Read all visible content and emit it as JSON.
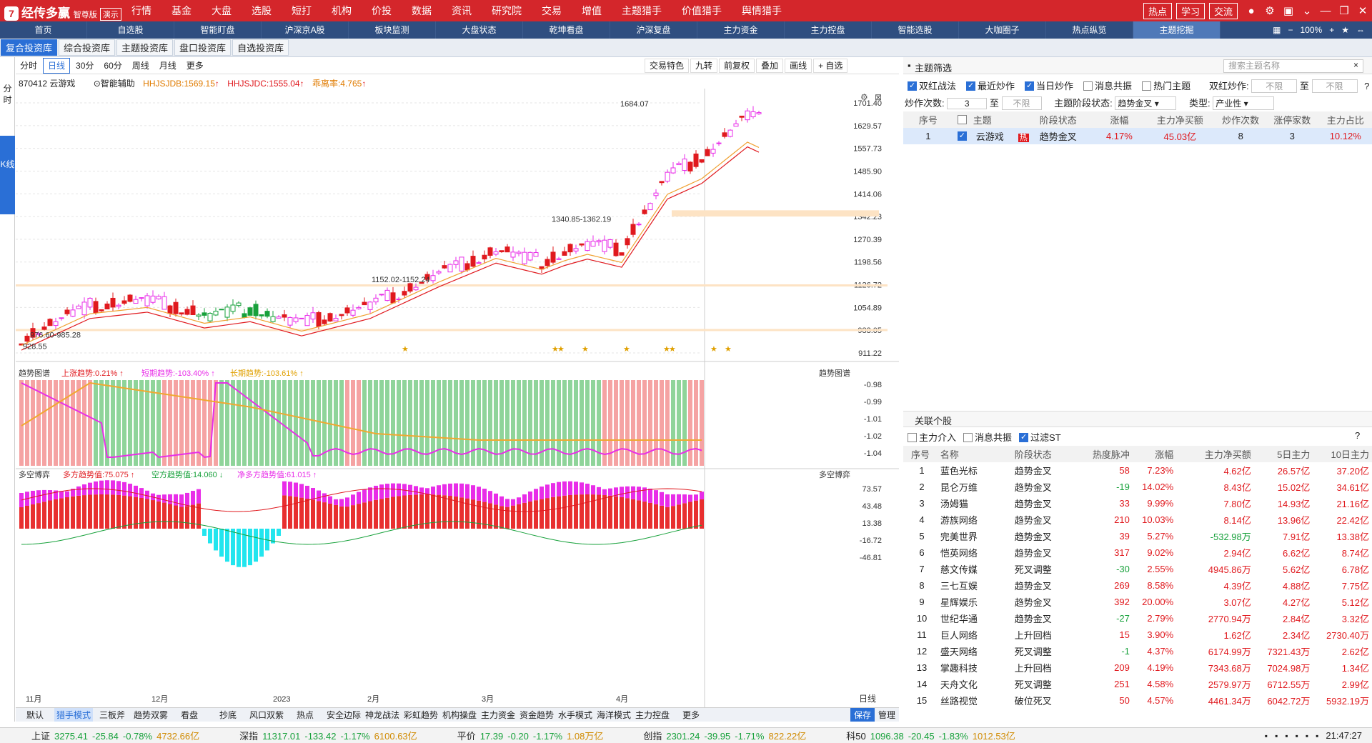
{
  "app": {
    "logo_glyph": "7",
    "title": "经传多赢",
    "edition": "智尊版",
    "demo": "演示"
  },
  "topmenu": [
    "行情",
    "基金",
    "大盘",
    "选股",
    "短打",
    "机构",
    "价投",
    "数据",
    "资讯",
    "研究院",
    "交易",
    "增值",
    "主题猎手",
    "价值猎手",
    "舆情猎手"
  ],
  "topright": {
    "btns": [
      "热点",
      "学习",
      "交流"
    ],
    "icons": [
      "user-icon",
      "gear-icon",
      "window-icon",
      "chevron-down-icon",
      "minimize-icon",
      "restore-icon",
      "close-icon"
    ]
  },
  "nav": [
    "首页",
    "自选股",
    "智能盯盘",
    "沪深京A股",
    "板块监测",
    "大盘状态",
    "乾坤看盘",
    "沪深复盘",
    "主力资金",
    "主力控盘",
    "智能选股",
    "大咖圈子",
    "热点纵览",
    "主题挖掘"
  ],
  "nav_active": 13,
  "navright": {
    "zoom": "100%"
  },
  "tabs": [
    "复合投资库",
    "综合投资库",
    "主题投资库",
    "盘口投资库",
    "自选投资库"
  ],
  "left_tabs": {
    "fenshi": "分时",
    "kxian": "K线"
  },
  "chart_periods": [
    "分时",
    "日线",
    "30分",
    "60分",
    "周线",
    "月线",
    "更多"
  ],
  "chart_period_active": 1,
  "chart_tools": [
    "交易特色",
    "九转",
    "前复权",
    "叠加",
    "画线",
    "+ 自选"
  ],
  "info": {
    "code": "870412 云游戏",
    "assist": "智能辅助",
    "hhjsjdb": "HHJSJDB:1569.15",
    "hhjsjdc": "HHJSJDC:1555.04",
    "dev": "乖离率:4.765"
  },
  "price_axis": [
    "1701.40",
    "1629.57",
    "1557.73",
    "1485.90",
    "1414.06",
    "1342.23",
    "1270.39",
    "1198.56",
    "1126.72",
    "1054.89",
    "983.05",
    "911.22"
  ],
  "annotations": {
    "high": "1684.07",
    "zone1": "1340.85-1362.19",
    "zone2": "1152.02-1152.24",
    "zone3": "976.60-985.28",
    "low": "928.55"
  },
  "trend": {
    "title": "趋势图谱",
    "a": "上涨趋势:0.21%",
    "b": "短期趋势:-103.40%",
    "c": "长期趋势:-103.61%",
    "axis": [
      "-0.98",
      "-0.99",
      "-1.01",
      "-1.02",
      "-1.04"
    ]
  },
  "dk": {
    "title": "多空博弈",
    "a": "多方趋势值:75.075",
    "b": "空方趋势值:14.060",
    "c": "净多方趋势值:61.015",
    "axis": [
      "73.57",
      "43.48",
      "13.38",
      "-16.72",
      "-46.81"
    ]
  },
  "months": [
    "11月",
    "12月",
    "2023",
    "2月",
    "3月",
    "4月"
  ],
  "period_label": "日线",
  "bottom_tabs": [
    "默认",
    "猎手模式",
    "三板斧",
    "趋势双雾",
    "看盘",
    "抄底",
    "风口双紫",
    "热点",
    "安全边际",
    "神龙战法",
    "彩虹趋势",
    "机构操盘",
    "主力资金",
    "资金趋势",
    "水手模式",
    "海洋模式",
    "主力控盘",
    "更多"
  ],
  "bottom_active": 1,
  "bottom_right": [
    "保存",
    "管理"
  ],
  "theme_filter": {
    "title": "主题筛选",
    "search_ph": "搜索主题名称",
    "checks": [
      {
        "l": "双红战法",
        "on": true
      },
      {
        "l": "最近炒作",
        "on": true
      },
      {
        "l": "当日炒作",
        "on": true
      },
      {
        "l": "消息共振",
        "on": false
      },
      {
        "l": "热门主题",
        "on": false
      }
    ],
    "shuanghong": "双红炒作:",
    "buxian": "不限",
    "zhi": "至",
    "chaozuo": "炒作次数:",
    "cz_val": "3",
    "stage_label": "主题阶段状态:",
    "stage_val": "趋势金叉",
    "type_label": "类型:",
    "type_val": "产业性"
  },
  "theme_table": {
    "headers": [
      "序号",
      "",
      "主题",
      "阶段状态",
      "涨幅",
      "主力净买额",
      "炒作次数",
      "涨停家数",
      "主力占比"
    ],
    "rows": [
      {
        "no": "1",
        "name": "云游戏",
        "hot": "热",
        "stage": "趋势金叉",
        "chg": "4.17%",
        "net": "45.03亿",
        "times": "8",
        "limit": "3",
        "ratio": "10.12%"
      }
    ]
  },
  "related": {
    "title": "关联个股",
    "checks": [
      {
        "l": "主力介入",
        "on": false
      },
      {
        "l": "消息共振",
        "on": false
      },
      {
        "l": "过滤ST",
        "on": true
      }
    ],
    "headers": [
      "序号",
      "名称",
      "阶段状态",
      "热度脉冲",
      "涨幅",
      "主力净买额",
      "5日主力",
      "10日主力"
    ],
    "rows": [
      {
        "no": "1",
        "n": "蓝色光标",
        "s": "趋势金叉",
        "h": "58",
        "c": "7.23%",
        "m": "4.62亿",
        "f": "26.57亿",
        "t": "37.20亿"
      },
      {
        "no": "2",
        "n": "昆仑万维",
        "s": "趋势金叉",
        "h": "-19",
        "c": "14.02%",
        "m": "8.43亿",
        "f": "15.02亿",
        "t": "34.61亿"
      },
      {
        "no": "3",
        "n": "汤姆猫",
        "s": "趋势金叉",
        "h": "33",
        "c": "9.99%",
        "m": "7.80亿",
        "f": "14.93亿",
        "t": "21.16亿"
      },
      {
        "no": "4",
        "n": "游族网络",
        "s": "趋势金叉",
        "h": "210",
        "c": "10.03%",
        "m": "8.14亿",
        "f": "13.96亿",
        "t": "22.42亿"
      },
      {
        "no": "5",
        "n": "完美世界",
        "s": "趋势金叉",
        "h": "39",
        "c": "5.27%",
        "m": "-532.98万",
        "f": "7.91亿",
        "t": "13.38亿"
      },
      {
        "no": "6",
        "n": "恺英网络",
        "s": "趋势金叉",
        "h": "317",
        "c": "9.02%",
        "m": "2.94亿",
        "f": "6.62亿",
        "t": "8.74亿"
      },
      {
        "no": "7",
        "n": "慈文传媒",
        "s": "死叉调整",
        "h": "-30",
        "c": "2.55%",
        "m": "4945.86万",
        "f": "5.62亿",
        "t": "6.78亿"
      },
      {
        "no": "8",
        "n": "三七互娱",
        "s": "趋势金叉",
        "h": "269",
        "c": "8.58%",
        "m": "4.39亿",
        "f": "4.88亿",
        "t": "7.75亿"
      },
      {
        "no": "9",
        "n": "星辉娱乐",
        "s": "趋势金叉",
        "h": "392",
        "c": "20.00%",
        "m": "3.07亿",
        "f": "4.27亿",
        "t": "5.12亿"
      },
      {
        "no": "10",
        "n": "世纪华通",
        "s": "趋势金叉",
        "h": "-27",
        "c": "2.79%",
        "m": "2770.94万",
        "f": "2.84亿",
        "t": "3.32亿"
      },
      {
        "no": "11",
        "n": "巨人网络",
        "s": "上升回档",
        "h": "15",
        "c": "3.90%",
        "m": "1.62亿",
        "f": "2.34亿",
        "t": "2730.40万"
      },
      {
        "no": "12",
        "n": "盛天网络",
        "s": "死叉调整",
        "h": "-1",
        "c": "4.37%",
        "m": "6174.99万",
        "f": "7321.43万",
        "t": "2.62亿"
      },
      {
        "no": "13",
        "n": "掌趣科技",
        "s": "上升回档",
        "h": "209",
        "c": "4.19%",
        "m": "7343.68万",
        "f": "7024.98万",
        "t": "1.34亿"
      },
      {
        "no": "14",
        "n": "天舟文化",
        "s": "死叉调整",
        "h": "251",
        "c": "4.58%",
        "m": "2579.97万",
        "f": "6712.55万",
        "t": "2.99亿"
      },
      {
        "no": "15",
        "n": "丝路视觉",
        "s": "破位死叉",
        "h": "50",
        "c": "4.57%",
        "m": "4461.34万",
        "f": "6042.72万",
        "t": "5932.19万"
      }
    ]
  },
  "status": [
    {
      "n": "上证",
      "p": "3275.41",
      "d": "-25.84",
      "r": "-0.78%",
      "v": "4732.66亿"
    },
    {
      "n": "深指",
      "p": "11317.01",
      "d": "-133.42",
      "r": "-1.17%",
      "v": "6100.63亿"
    },
    {
      "n": "平价",
      "p": "17.39",
      "d": "-0.20",
      "r": "-1.17%",
      "v": "1.08万亿"
    },
    {
      "n": "创指",
      "p": "2301.24",
      "d": "-39.95",
      "r": "-1.71%",
      "v": "822.22亿"
    },
    {
      "n": "科50",
      "p": "1096.38",
      "d": "-20.45",
      "r": "-1.83%",
      "v": "1012.53亿"
    }
  ],
  "clock": "21:47:27",
  "colors": {
    "red": "#e0191e",
    "green": "#17a13b",
    "magenta": "#e82de8",
    "brand": "#d4262b",
    "nav": "#2f4e80"
  }
}
